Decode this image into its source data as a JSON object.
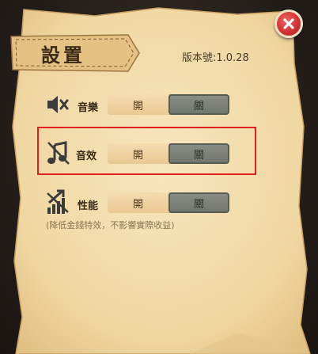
{
  "header": {
    "title": "設置",
    "version": "版本號:1.0.28"
  },
  "settings": {
    "music": {
      "label": "音樂",
      "on": "開",
      "off": "關",
      "selected": "off",
      "icon": "speaker-muted-icon"
    },
    "sfx": {
      "label": "音效",
      "on": "開",
      "off": "關",
      "selected": "off",
      "icon": "music-note-muted-icon"
    },
    "performance": {
      "label": "性能",
      "on": "開",
      "off": "關",
      "selected": "off",
      "icon": "performance-chart-icon",
      "note": "(降低金錢特效，不影響實際收益)"
    }
  },
  "colors": {
    "paper": "#f3dcaa",
    "accent_red": "#e02020",
    "close_red": "#d23434",
    "toggle_off": "#7a817a",
    "toggle_on": "#f0d4a4"
  }
}
